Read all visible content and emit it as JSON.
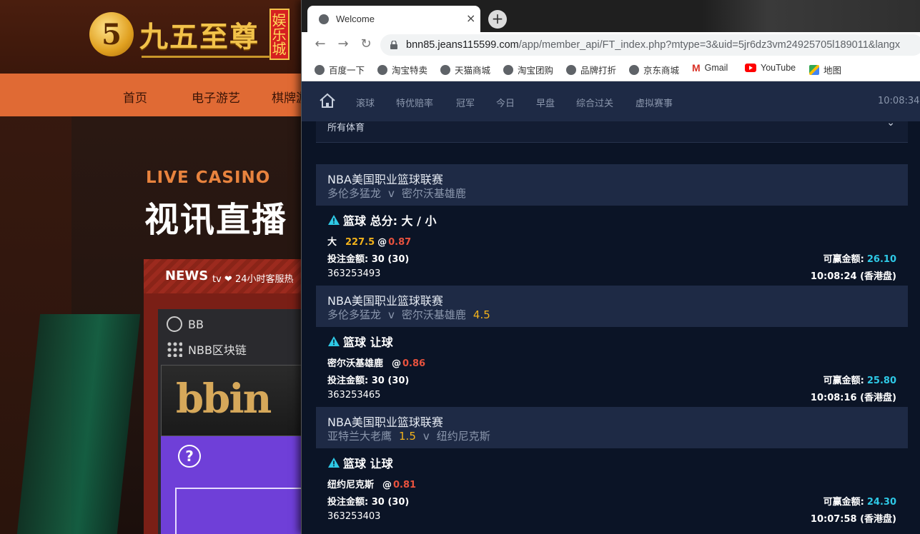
{
  "background_site": {
    "logo_name": "九五至尊",
    "logo_badge": "娱乐城",
    "nav": [
      "首页",
      "电子游艺",
      "棋牌游"
    ],
    "live_casino": "LIVE CASINO",
    "live_casino_cn": "视讯直播",
    "news_label": "NEWS",
    "news_ticker": "tv ❤ 24小时客服热",
    "games": [
      "BB",
      "NBB区块链"
    ],
    "bbin_logo": "bbin",
    "help_glyph": "?"
  },
  "browser": {
    "tab_title": "Welcome",
    "tab_close": "×",
    "new_tab": "+",
    "url_host": "bnn85.jeans115599.com",
    "url_path": "/app/member_api/FT_index.php?mtype=3&uid=5jr6dz3vm24925705l189011&langx",
    "bookmarks": [
      {
        "label": "百度一下",
        "icon": "globe-icon"
      },
      {
        "label": "淘宝特卖",
        "icon": "globe-icon"
      },
      {
        "label": "天猫商城",
        "icon": "globe-icon"
      },
      {
        "label": "淘宝团购",
        "icon": "globe-icon"
      },
      {
        "label": "品牌打折",
        "icon": "globe-icon"
      },
      {
        "label": "京东商城",
        "icon": "globe-icon"
      },
      {
        "label": "Gmail",
        "icon": "gmail-icon"
      },
      {
        "label": "YouTube",
        "icon": "youtube-icon"
      },
      {
        "label": "地图",
        "icon": "maps-icon"
      }
    ]
  },
  "app": {
    "nav": [
      "滚球",
      "特优赔率",
      "冠军",
      "今日",
      "早盘",
      "综合过关",
      "虚拟赛事"
    ],
    "clock": "10:08:34",
    "sport_filter": "所有体育",
    "bets": [
      {
        "league": "NBA美国职业篮球联赛",
        "home": "多伦多猛龙",
        "home_hcp": "",
        "vs": "v",
        "away": "密尔沃基雄鹿",
        "away_hcp": "",
        "bet_type": "篮球 总分: 大 / 小",
        "selection": "大",
        "line": "227.5",
        "at": "@",
        "odds": "0.87",
        "stake_label": "投注金额:",
        "stake": "30 (30)",
        "win_label": "可赢金额:",
        "win": "26.10",
        "ticket": "363253493",
        "time": "10:08:24 (香港盘)"
      },
      {
        "league": "NBA美国职业篮球联赛",
        "home": "多伦多猛龙",
        "home_hcp": "",
        "vs": "v",
        "away": "密尔沃基雄鹿",
        "away_hcp": "4.5",
        "bet_type": "篮球 让球",
        "selection": "密尔沃基雄鹿",
        "line": "",
        "at": "@",
        "odds": "0.86",
        "stake_label": "投注金额:",
        "stake": "30 (30)",
        "win_label": "可赢金额:",
        "win": "25.80",
        "ticket": "363253465",
        "time": "10:08:16 (香港盘)"
      },
      {
        "league": "NBA美国职业篮球联赛",
        "home": "亚特兰大老鹰",
        "home_hcp": "1.5",
        "vs": "v",
        "away": "纽约尼克斯",
        "away_hcp": "",
        "bet_type": "篮球 让球",
        "selection": "纽约尼克斯",
        "line": "",
        "at": "@",
        "odds": "0.81",
        "stake_label": "投注金额:",
        "stake": "30 (30)",
        "win_label": "可赢金额:",
        "win": "24.30",
        "ticket": "363253403",
        "time": "10:07:58 (香港盘)"
      }
    ]
  },
  "colors": {
    "accent_orange": "#e06a34",
    "app_nav_bg": "#1e2a45",
    "odds_red": "#e8523e",
    "line_yellow": "#f2b21b",
    "win_cyan": "#2ec9e6"
  }
}
